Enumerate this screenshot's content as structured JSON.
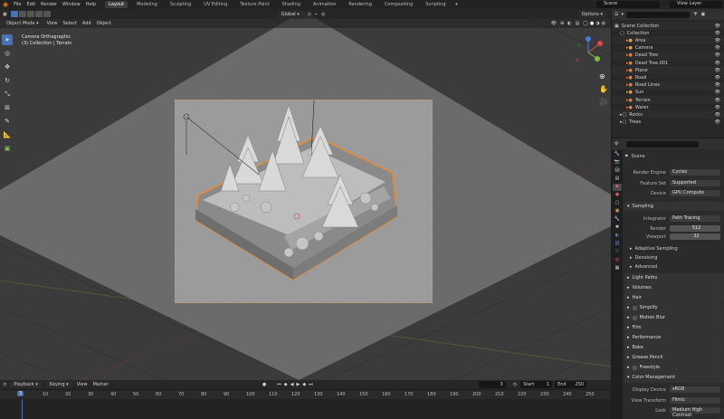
{
  "topbar": {
    "menus": [
      "File",
      "Edit",
      "Render",
      "Window",
      "Help"
    ],
    "workspaces": [
      "Layout",
      "Modeling",
      "Sculpting",
      "UV Editing",
      "Texture Paint",
      "Shading",
      "Animation",
      "Rendering",
      "Compositing",
      "Scripting"
    ],
    "active_workspace": "Layout",
    "scene": "Scene",
    "view_layer": "View Layer"
  },
  "viewport": {
    "mode": "Object Mode",
    "menus": [
      "View",
      "Select",
      "Add",
      "Object"
    ],
    "transform": "Global",
    "options": "Options",
    "info_line1": "Camera Orthographic",
    "info_line2": "(3) Collection | Terrain"
  },
  "timeline": {
    "menus": [
      "Playback",
      "Keying",
      "View",
      "Marker"
    ],
    "current_frame": "3",
    "start_label": "Start",
    "start": "1",
    "end_label": "End",
    "end": "250",
    "ticks": [
      "0",
      "10",
      "20",
      "30",
      "40",
      "50",
      "60",
      "70",
      "80",
      "90",
      "100",
      "110",
      "120",
      "130",
      "140",
      "150",
      "160",
      "170",
      "180",
      "190",
      "200",
      "210",
      "220",
      "230",
      "240",
      "250"
    ],
    "playhead": "3"
  },
  "outliner": {
    "root": "Scene Collection",
    "collection": "Collection",
    "items": [
      {
        "label": "Area",
        "color": "#e0a050"
      },
      {
        "label": "Camera",
        "color": "#e0a050"
      },
      {
        "label": "Dead Tree",
        "color": "#e08040"
      },
      {
        "label": "Dead Tree.001",
        "color": "#e08040"
      },
      {
        "label": "Plane",
        "color": "#e08040"
      },
      {
        "label": "Road",
        "color": "#e08040"
      },
      {
        "label": "Road Lines",
        "color": "#e08040"
      },
      {
        "label": "Sun",
        "color": "#e0a050"
      },
      {
        "label": "Terrain",
        "color": "#e08040"
      },
      {
        "label": "Water",
        "color": "#e08040"
      }
    ],
    "selected": "Terrain",
    "collections": [
      "Rocks",
      "Trees"
    ]
  },
  "properties": {
    "context": "Scene",
    "render_engine_label": "Render Engine",
    "render_engine": "Cycles",
    "feature_set_label": "Feature Set",
    "feature_set": "Supported",
    "device_label": "Device",
    "device": "GPU Compute",
    "sampling": "Sampling",
    "integrator_label": "Integrator",
    "integrator": "Path Tracing",
    "render_label": "Render",
    "render": "512",
    "viewport_label": "Viewport",
    "viewport": "32",
    "subsections": [
      "Adaptive Sampling",
      "Denoising",
      "Advanced"
    ],
    "panels": [
      "Light Paths",
      "Volumes",
      "Hair",
      "Simplify",
      "Motion Blur",
      "Film",
      "Performance",
      "Bake",
      "Grease Pencil",
      "Freestyle",
      "Color Management"
    ],
    "display_device_label": "Display Device",
    "display_device": "sRGB",
    "view_transform_label": "View Transform",
    "view_transform": "Filmic",
    "look_label": "Look",
    "look": "Medium High Contrast"
  },
  "colors": {
    "accent": "#4772b3",
    "selection_outline": "#f08a24"
  }
}
